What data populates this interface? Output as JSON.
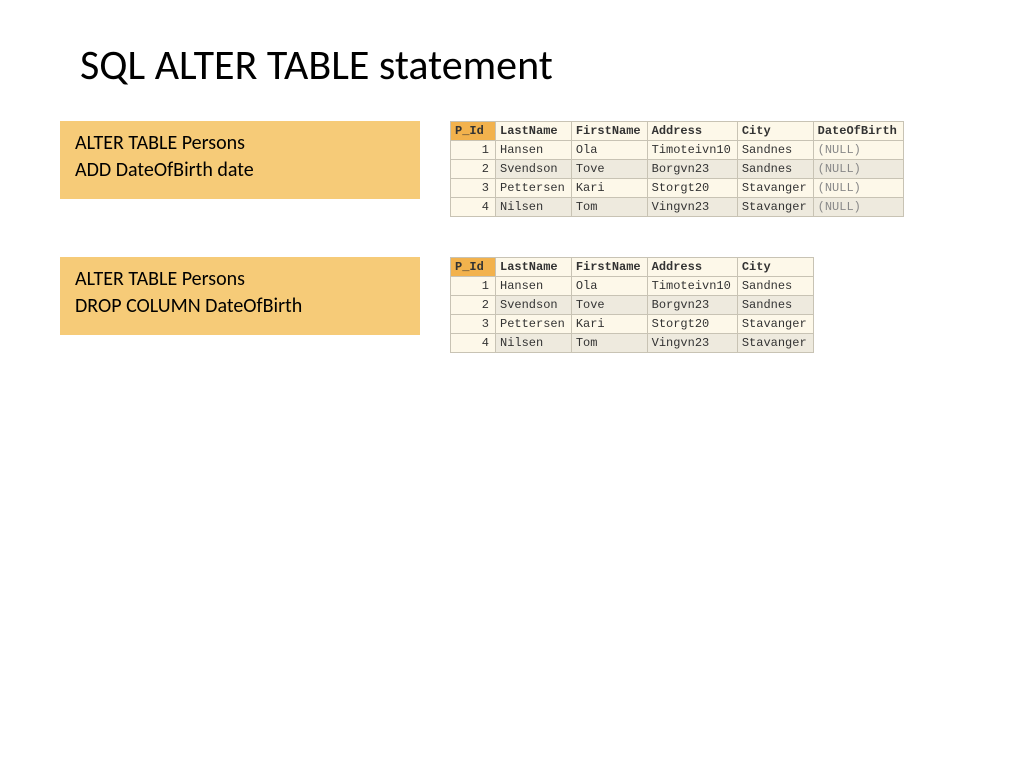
{
  "title": "SQL ALTER TABLE statement",
  "example1": {
    "sql_line1": "ALTER TABLE Persons",
    "sql_line2": "ADD DateOfBirth date",
    "headers": [
      "P_Id",
      "LastName",
      "FirstName",
      "Address",
      "City",
      "DateOfBirth"
    ],
    "rows": [
      [
        "1",
        "Hansen",
        "Ola",
        "Timoteivn10",
        "Sandnes",
        "(NULL)"
      ],
      [
        "2",
        "Svendson",
        "Tove",
        "Borgvn23",
        "Sandnes",
        "(NULL)"
      ],
      [
        "3",
        "Pettersen",
        "Kari",
        "Storgt20",
        "Stavanger",
        "(NULL)"
      ],
      [
        "4",
        "Nilsen",
        "Tom",
        "Vingvn23",
        "Stavanger",
        "(NULL)"
      ]
    ]
  },
  "example2": {
    "sql_line1": "ALTER TABLE Persons",
    "sql_line2": "DROP COLUMN DateOfBirth",
    "headers": [
      "P_Id",
      "LastName",
      "FirstName",
      "Address",
      "City"
    ],
    "rows": [
      [
        "1",
        "Hansen",
        "Ola",
        "Timoteivn10",
        "Sandnes"
      ],
      [
        "2",
        "Svendson",
        "Tove",
        "Borgvn23",
        "Sandnes"
      ],
      [
        "3",
        "Pettersen",
        "Kari",
        "Storgt20",
        "Stavanger"
      ],
      [
        "4",
        "Nilsen",
        "Tom",
        "Vingvn23",
        "Stavanger"
      ]
    ]
  }
}
